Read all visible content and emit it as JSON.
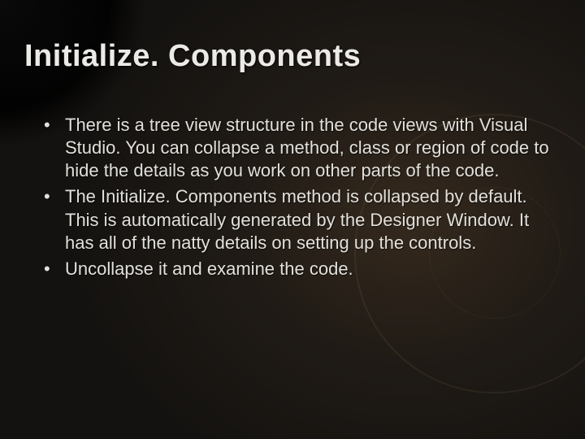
{
  "title": "Initialize. Components",
  "bullets": [
    "There is a tree view structure in the code views with Visual Studio. You can collapse a method, class or region of code to hide the details as you work on other parts of the code.",
    "The Initialize. Components method is collapsed by default. This is automatically generated by the Designer Window. It has all of the natty details on setting up the controls.",
    "Uncollapse it and examine the code."
  ]
}
